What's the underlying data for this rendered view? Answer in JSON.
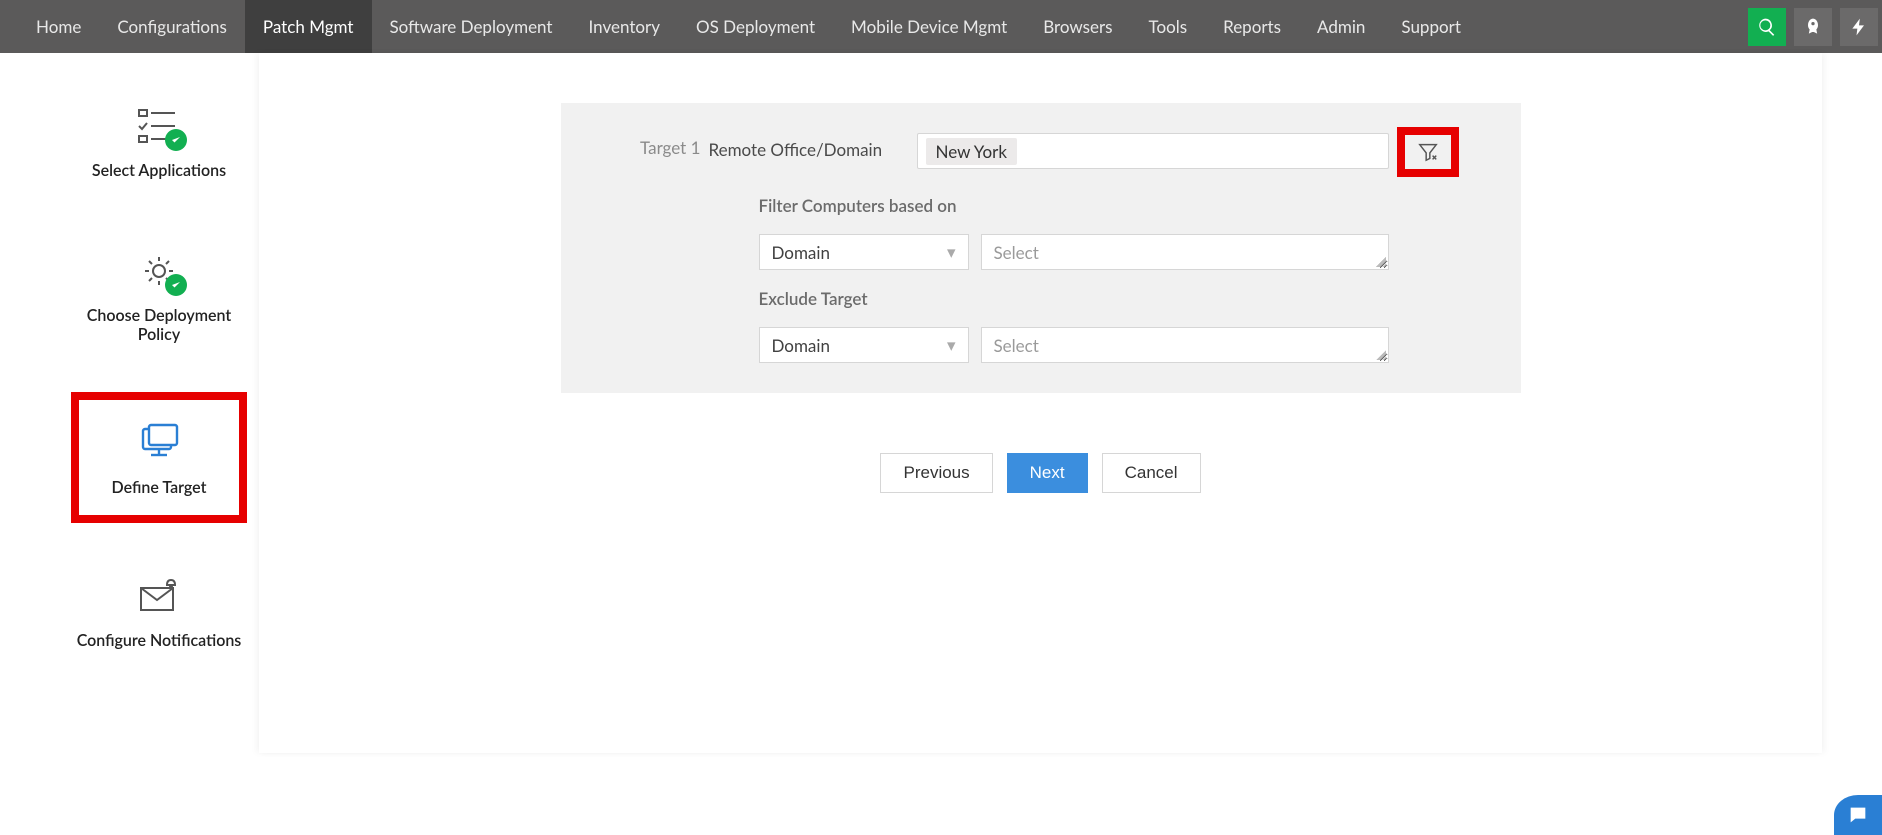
{
  "topnav": {
    "items": [
      "Home",
      "Configurations",
      "Patch Mgmt",
      "Software Deployment",
      "Inventory",
      "OS Deployment",
      "Mobile Device Mgmt",
      "Browsers",
      "Tools",
      "Reports",
      "Admin",
      "Support"
    ],
    "active_index": 2
  },
  "stepper": {
    "steps": [
      {
        "label": "Select Applications",
        "icon": "apps"
      },
      {
        "label": "Choose Deployment Policy",
        "icon": "gear"
      },
      {
        "label": "Define Target",
        "icon": "monitor"
      },
      {
        "label": "Configure Notifications",
        "icon": "mail"
      }
    ],
    "highlight_index": 2
  },
  "target": {
    "title": "Target 1",
    "row1_label": "Remote Office/Domain",
    "selected_tag": "New York",
    "filter_header": "Filter Computers based on",
    "filter_dd": "Domain",
    "filter_select_placeholder": "Select",
    "exclude_header": "Exclude Target",
    "exclude_dd": "Domain",
    "exclude_select_placeholder": "Select"
  },
  "footer": {
    "prev": "Previous",
    "next": "Next",
    "cancel": "Cancel"
  }
}
